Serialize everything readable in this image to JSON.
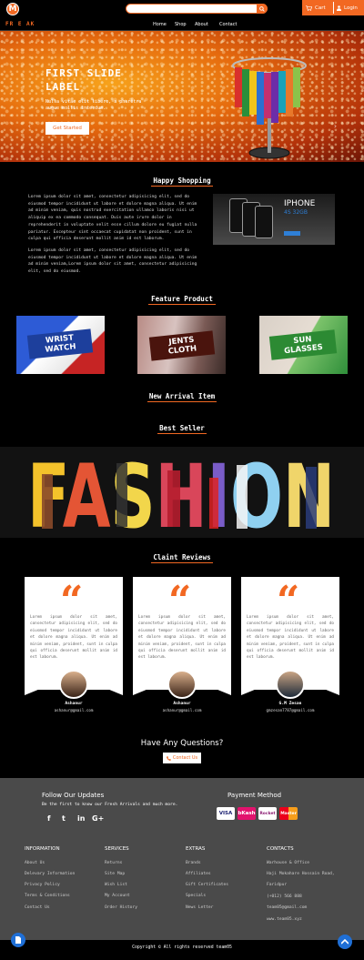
{
  "header": {
    "logo": "M",
    "search_placeholder": "",
    "cart_label": "Cart",
    "login_label": "Login"
  },
  "nav": {
    "brand": "FR E AK",
    "links": [
      "Home",
      "Shop",
      "About",
      "Contact"
    ]
  },
  "hero": {
    "title": "FIRST SLIDE LABEL",
    "subtitle": "Nulla vitae elit libero, a pharetra augue mollis interdum.",
    "button": "Get Started",
    "prev": "‹",
    "next": "›"
  },
  "happy": {
    "title": "Happy Shopping",
    "para1": "Lorem ipsum dolor sit amet, consectetur adipisicing elit, sed do eiusmod tempor incididunt ut labore et dolore magna aliqua. Ut enim ad minim veniam, quis nostrud exercitation ullamco laboris nisi ut aliquip ex ea commodo consequat. Duis aute irure dolor in reprehenderit in voluptate velit esse cillum dolore eu fugiat nulla pariatur. Excepteur sint occaecat cupidatat non proident, sunt in culpa qui officia deserunt mollit anim id est laborum.",
    "para2": "Lorem ipsum dolor sit amet, consectetur adipisicing elit, sed do eiusmod tempor incididunt ut labore et dolore magna aliqua. Ut enim ad minim veniam,Lorem ipsum dolor sit amet, consectetur adipisicing elit, sed do eiusmod.",
    "promo_title": "IPHONE",
    "promo_sub": "4S 32GB"
  },
  "featured": {
    "title": "Feature Product",
    "items": [
      {
        "line1": "WRIST",
        "line2": "WATCH"
      },
      {
        "line1": "JENTS",
        "line2": "CLOTH"
      },
      {
        "line1": "SUN",
        "line2": "GLASSES"
      }
    ]
  },
  "new_arrival": {
    "title": "New Arrival Item"
  },
  "best_seller": {
    "title": "Best Seller",
    "banner": "FASHION"
  },
  "reviews": {
    "title": "Claint Reviews",
    "quote_mark": "“",
    "items": [
      {
        "text": "Lorem ipsum dolor sit amet, consectetur adipisicing elit, sed do eiusmod tempor incididunt ut labore et dolore magna aliqua. Ut enim ad minim veniam, proident, sunt in culpa qui officia deserunt mollit anim id est laborum.",
        "name": "Ashanur",
        "email": "ashanur@gmail.com"
      },
      {
        "text": "Lorem ipsum dolor sit amet, consectetur adipisicing elit, sed do eiusmod tempor incididunt ut labore et dolore magna aliqua. Ut enim ad minim veniam, proident, sunt in culpa qui officia deserunt mollit anim id est laborum.",
        "name": "Ashanur",
        "email": "ashanur@gmail.com"
      },
      {
        "text": "Lorem ipsum dolor sit amet, consectetur adipisicing elit, sed do eiusmod tempor incididunt ut labore et dolore magna aliqua. Ut enim ad minim veniam, proident, sunt in culpa qui officia deserunt mollit anim id est laborum.",
        "name": "G.M Zesan",
        "email": "gmzesan7787@gmail.com"
      }
    ]
  },
  "ask": {
    "title": "Have Any Questions?",
    "button": "Contact Us"
  },
  "footer": {
    "follow_title": "Follow Our Updates",
    "follow_sub": "Be the first to know our Fresh Arrivals and much more.",
    "social": [
      "f",
      "t",
      "in",
      "G+"
    ],
    "payment_title": "Payment Method",
    "payments": [
      "VISA",
      "bKash",
      "Rocket",
      "Master"
    ],
    "columns": [
      {
        "title": "INFORMATION",
        "items": [
          "About Us",
          "Delevary Information",
          "Privacy Policy",
          "Terms & Conditions",
          "Contact Us"
        ]
      },
      {
        "title": "SERVICES",
        "items": [
          "Returns",
          "Site Map",
          "Wish List",
          "My Account",
          "Order History"
        ]
      },
      {
        "title": "EXTRAS",
        "items": [
          "Brands",
          "Affiliates",
          "Gift Certificates",
          "Specials",
          "News Letter"
        ]
      },
      {
        "title": "CONTACTS",
        "items": [
          "Warhouse & Office",
          "Haji Mokahare Hossain Road,",
          "Faridpur",
          "(+012) 566 888",
          "team05@gmail.com",
          "www.team05.xyz"
        ]
      }
    ],
    "copyright": "Copyright © All rights reserved team05"
  },
  "colors": {
    "accent": "#f26822",
    "footer_bg": "#4a4a4a"
  }
}
